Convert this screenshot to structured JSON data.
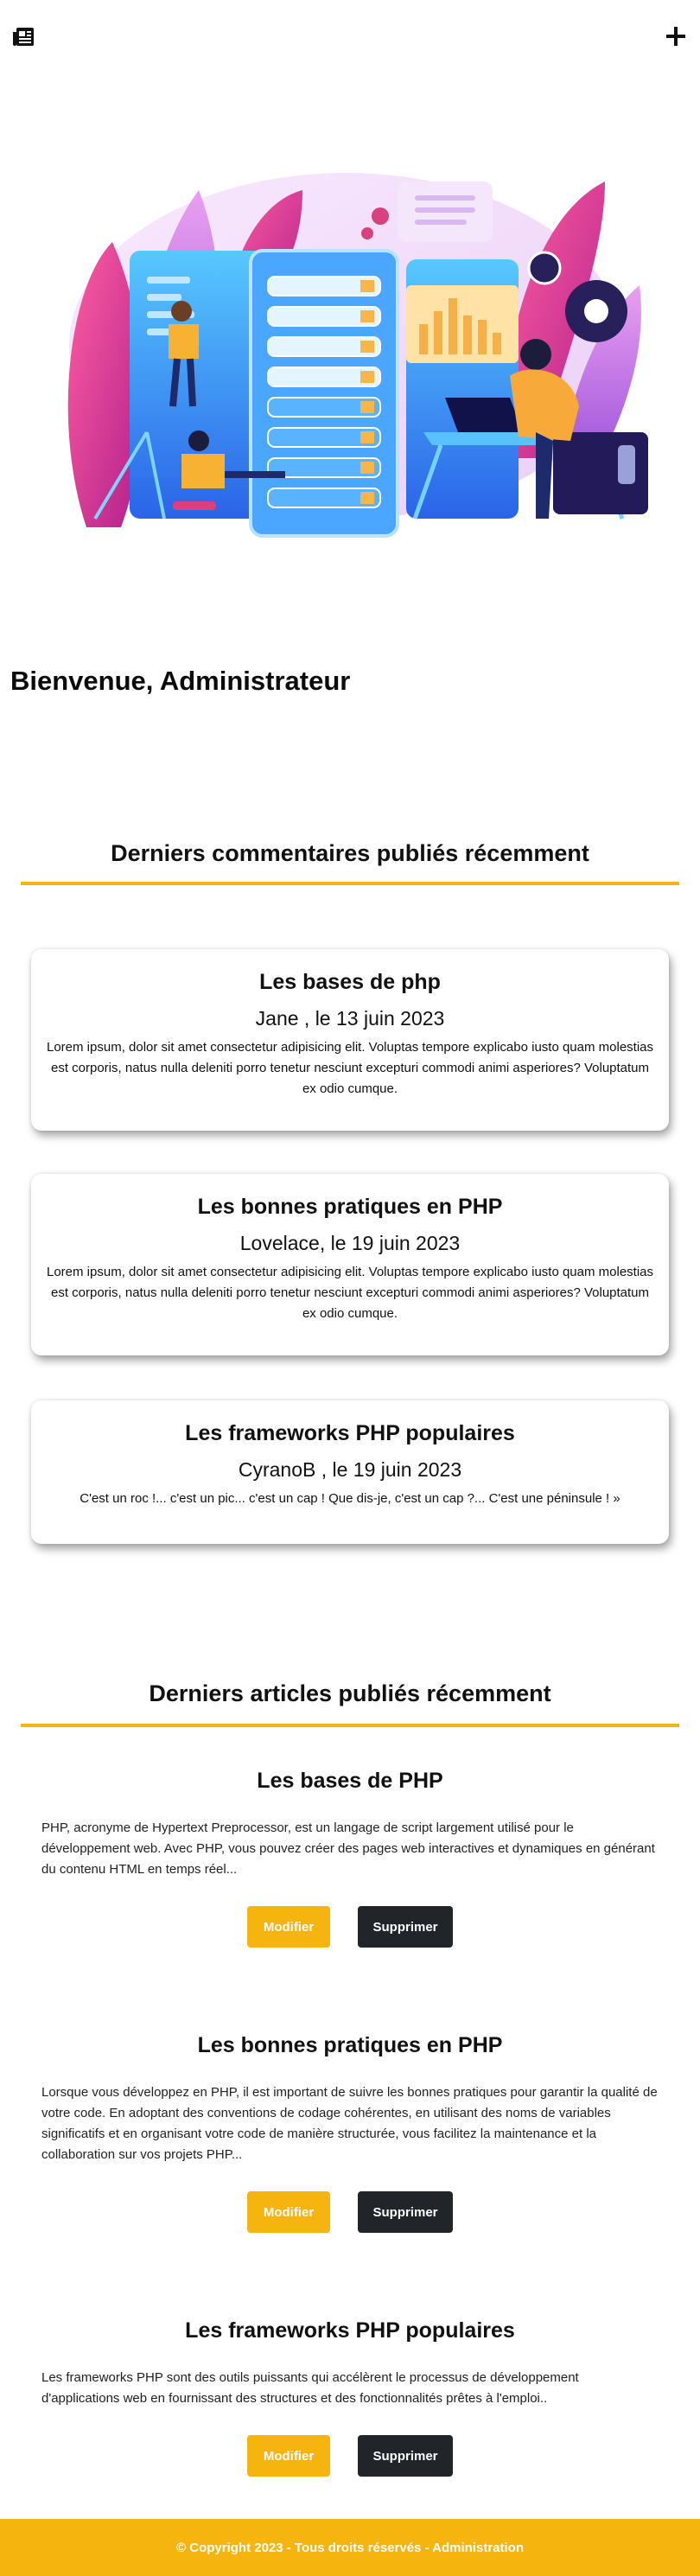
{
  "nav": {
    "left_icon": "newspaper-icon",
    "right_icon": "plus-icon"
  },
  "hero": {
    "illustration": "server-datacenter-illustration"
  },
  "welcome": {
    "title": "Bienvenue, Administrateur"
  },
  "comments_section": {
    "title": "Derniers commentaires publiés récemment",
    "cards": [
      {
        "title": "Les bases de php",
        "author": "Jane , le 13 juin 2023",
        "text": "Lorem ipsum, dolor sit amet consectetur adipisicing elit. Voluptas tempore explicabo iusto quam molestias est corporis, natus nulla deleniti porro tenetur nesciunt excepturi commodi animi asperiores? Voluptatum ex odio cumque."
      },
      {
        "title": "Les bonnes pratiques en PHP",
        "author": "Lovelace, le 19 juin 2023",
        "text": "Lorem ipsum, dolor sit amet consectetur adipisicing elit. Voluptas tempore explicabo iusto quam molestias est corporis, natus nulla deleniti porro tenetur nesciunt excepturi commodi animi asperiores? Voluptatum ex odio cumque."
      },
      {
        "title": "Les frameworks PHP populaires",
        "author": "CyranoB , le 19 juin 2023",
        "text": "C'est un roc !... c'est un pic... c'est un cap ! Que dis-je, c'est un cap ?... C'est une péninsule ! »"
      }
    ]
  },
  "articles_section": {
    "title": "Derniers articles publiés récemment",
    "edit_label": "Modifier",
    "delete_label": "Supprimer",
    "articles": [
      {
        "title": "Les bases de PHP",
        "text": "PHP, acronyme de Hypertext Preprocessor, est un langage de script largement utilisé pour le développement web. Avec PHP, vous pouvez créer des pages web interactives et dynamiques en générant du contenu HTML en temps réel..."
      },
      {
        "title": "Les bonnes pratiques en PHP",
        "text": "Lorsque vous développez en PHP, il est important de suivre les bonnes pratiques pour garantir la qualité de votre code. En adoptant des conventions de codage cohérentes, en utilisant des noms de variables significatifs et en organisant votre code de manière structurée, vous facilitez la maintenance et la collaboration sur vos projets PHP..."
      },
      {
        "title": "Les frameworks PHP populaires",
        "text": "Les frameworks PHP sont des outils puissants qui accélèrent le processus de développement d'applications web en fournissant des structures et des fonctionnalités prêtes à l'emploi.."
      }
    ]
  },
  "footer": {
    "text": "© Copyright 2023 - Tous droits réservés - Administration"
  },
  "colors": {
    "accent": "#f6b40e",
    "dark_button": "#212529"
  }
}
